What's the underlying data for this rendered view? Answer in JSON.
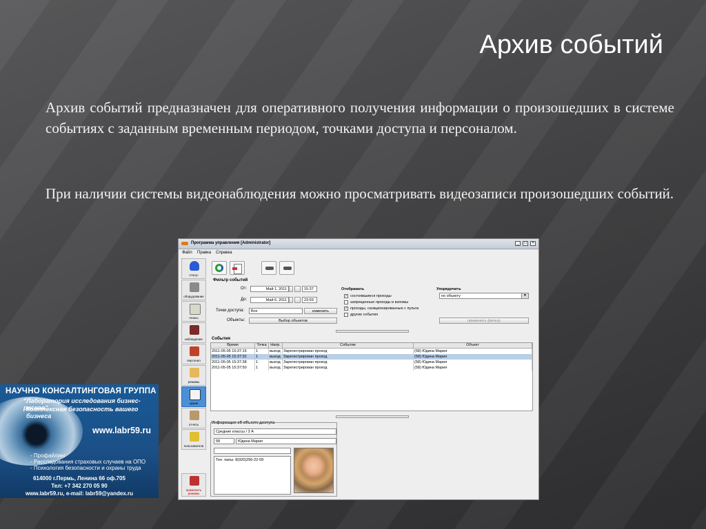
{
  "slide": {
    "title": "Архив событий",
    "paragraph1": "Архив событий предназначен для оперативного получения информации о произошедших в системе событиях с заданным временным периодом, точками доступа и персоналом.",
    "paragraph2": "При наличии системы видеонаблюдения можно просматривать видеозаписи произошедших событий."
  },
  "banner": {
    "title": "НАУЧНО КОНСАЛТИНГОВАЯ ГРУППА",
    "sub1": "\"Лаборатория исследования бизнес-рисков\"",
    "sub2": "Комплексная безопасность вашего бизнеса",
    "url": "www.labr59.ru",
    "list1": "- Профайлинг",
    "list2": "- Расследования страховых случаев на ОПО",
    "list3": "- Психология безопасности и охраны труда",
    "addr1": "614000 г.Пермь, Ленина 66 оф.705",
    "addr2": "Тел: +7 342 270 05 90",
    "addr3": "www.labr59.ru, e-mail: labr59@yandex.ru"
  },
  "window": {
    "title": "Программа управления [Administrator]",
    "menu": [
      "Файл",
      "Правка",
      "Справка"
    ],
    "sidebar": [
      "статус",
      "оборудование",
      "планы",
      "наблюдение",
      "персонал",
      "режимы",
      "архив",
      "отчеты",
      "пользователи",
      "применить режимы"
    ],
    "filter": {
      "header": "Фильтр событий",
      "from_label": "От:",
      "from_date": "Май 1, 2011",
      "from_time": "15:37",
      "to_label": "До:",
      "to_date": "Май 6, 2011",
      "to_time": "23:59",
      "points_label": "Точки доступа:",
      "points_value": "Все",
      "change_btn": "изменить",
      "objects_label": "Объекты:",
      "objects_btn": "Выбор объектов"
    },
    "display": {
      "header": "Отображать",
      "opt1": "состоявшиеся проходы",
      "opt2": "запрещенные проходы и взломы",
      "opt3": "проходы, санкционированные с пульта",
      "opt4": "другие события"
    },
    "order": {
      "header": "Упорядочить",
      "value": "по объекту",
      "apply_btn": "применить фильтр"
    },
    "events": {
      "header": "События",
      "columns": [
        "Время",
        "Точка",
        "Напр.",
        "Событие",
        "Объект"
      ],
      "rows": [
        [
          "2011-05-05 15:37:15",
          "1",
          "выход",
          "Зарегистрирован проход",
          "(58) Юдина Мария"
        ],
        [
          "2011-05-05 15:37:32",
          "1",
          "выход",
          "Зарегистрирован проход",
          "(58) Юдина Мария"
        ],
        [
          "2011-05-05 15:37:38",
          "1",
          "выход",
          "Зарегистрирован проход",
          "(58) Юдина Мария"
        ],
        [
          "2011-05-05 15:37:50",
          "1",
          "выход",
          "Зарегистрирован проход",
          "(58) Юдина Мария"
        ]
      ]
    },
    "info": {
      "header": "Информация об объекте доступа",
      "group": "Средние классы / 3 А",
      "id": "58",
      "name": "Юдина Мария",
      "phone": "Тел. папы: 8(920)296-22-09"
    }
  }
}
